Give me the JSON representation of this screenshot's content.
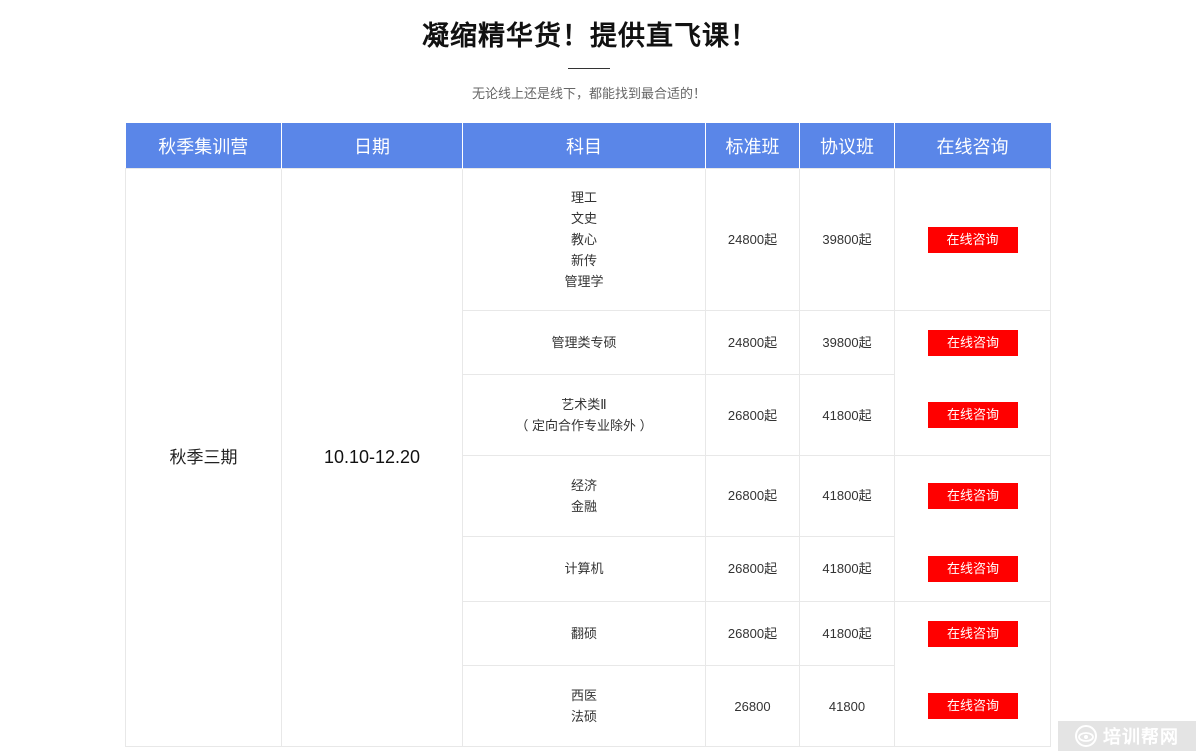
{
  "header": {
    "title": "凝缩精华货！提供直飞课！",
    "subtitle": "无论线上还是线下，都能找到最合适的！"
  },
  "table": {
    "columns": [
      "秋季集训营",
      "日期",
      "科目",
      "标准班",
      "协议班",
      "在线咨询"
    ],
    "camp": "秋季三期",
    "date": "10.10-12.20",
    "rows": [
      {
        "subjects": [
          "理工",
          "文史",
          "教心",
          "新传",
          "管理学"
        ],
        "standard": "24800起",
        "agreement": "39800起"
      },
      {
        "subjects": [
          "管理类专硕"
        ],
        "standard": "24800起",
        "agreement": "39800起"
      },
      {
        "subjects": [
          "艺术类Ⅱ",
          "（ 定向合作专业除外 ）"
        ],
        "standard": "26800起",
        "agreement": "41800起"
      },
      {
        "subjects": [
          "经济",
          "金融"
        ],
        "standard": "26800起",
        "agreement": "41800起"
      },
      {
        "subjects": [
          "计算机"
        ],
        "standard": "26800起",
        "agreement": "41800起"
      },
      {
        "subjects": [
          "翻硕"
        ],
        "standard": "26800起",
        "agreement": "41800起"
      },
      {
        "subjects": [
          "西医",
          "法硕"
        ],
        "standard": "26800",
        "agreement": "41800"
      }
    ],
    "consult_label": "在线咨询"
  },
  "watermark": {
    "text": "培训帮网",
    "icon": "eye-logo-icon"
  },
  "colors": {
    "header_bg": "#5a86e8",
    "button_bg": "#ff0000",
    "border": "#e8e8e8"
  }
}
